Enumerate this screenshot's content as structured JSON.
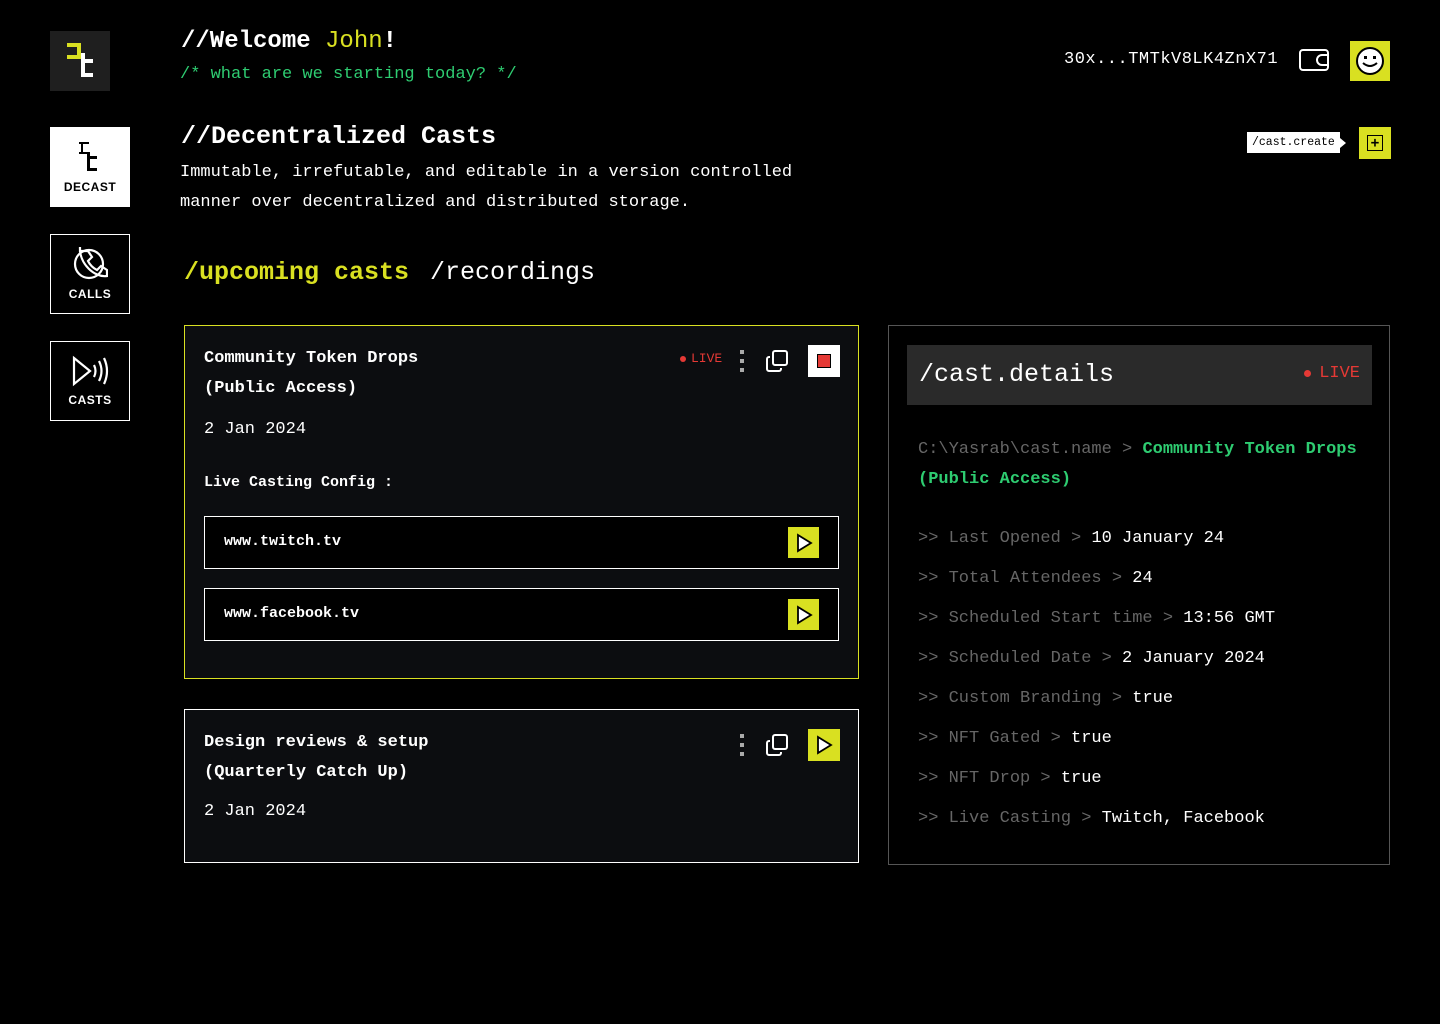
{
  "sidebar": {
    "items": [
      {
        "label": "DECAST"
      },
      {
        "label": "CALLS"
      },
      {
        "label": "CASTS"
      }
    ]
  },
  "header": {
    "welcome_prefix": "//Welcome ",
    "user_name": "John",
    "welcome_suffix": "!",
    "subtitle": "/* what are we starting today? */",
    "wallet_address": "30x...TMTkV8LK4ZnX71"
  },
  "section": {
    "title": "//Decentralized Casts",
    "description": "Immutable, irrefutable, and editable in a version controlled manner over decentralized and distributed storage.",
    "create_tooltip": "/cast.create",
    "create_button": "+"
  },
  "tabs": [
    {
      "label": "/upcoming casts",
      "active": true
    },
    {
      "label": "/recordings",
      "active": false
    }
  ],
  "casts": [
    {
      "title_line1": "Community Token Drops",
      "title_line2": "(Public Access)",
      "date": "2 Jan 2024",
      "live_label": "LIVE",
      "config_label": "Live Casting Config :",
      "platforms": [
        "www.twitch.tv",
        "www.facebook.tv"
      ]
    },
    {
      "title_line1": "Design reviews & setup",
      "title_line2": "(Quarterly Catch Up)",
      "date": "2 Jan 2024"
    }
  ],
  "details": {
    "title": "/cast.details",
    "live_label": "LIVE",
    "path_prefix": "C:\\Yasrab\\cast.name > ",
    "cast_name": "Community Token Drops (Public Access)",
    "rows": [
      {
        "key": ">> Last Opened > ",
        "value": "10 January 24"
      },
      {
        "key": ">> Total Attendees > ",
        "value": "24"
      },
      {
        "key": ">> Scheduled Start time > ",
        "value": "13:56 GMT"
      },
      {
        "key": ">> Scheduled Date > ",
        "value": "2 January 2024"
      },
      {
        "key": ">> Custom Branding > ",
        "value": "true"
      },
      {
        "key": ">> NFT Gated > ",
        "value": "true"
      },
      {
        "key": ">> NFT Drop > ",
        "value": "true"
      },
      {
        "key": ">> Live Casting > ",
        "value": "Twitch, Facebook"
      }
    ]
  },
  "colors": {
    "accent": "#d9e021",
    "green": "#2ecc71",
    "live_red": "#e53935",
    "background": "#000000"
  }
}
